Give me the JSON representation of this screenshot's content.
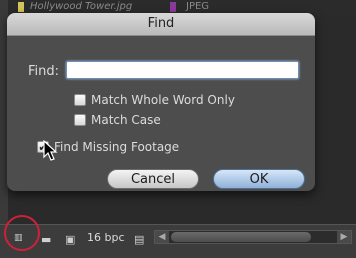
{
  "background": {
    "row_name": "Hollywood Tower.jpg",
    "row_type": "JPEG"
  },
  "dialog": {
    "title": "Find",
    "find_label": "Find:",
    "find_value": "",
    "match_whole_word": {
      "label": "Match Whole Word Only",
      "checked": false
    },
    "match_case": {
      "label": "Match Case",
      "checked": false
    },
    "find_missing_footage": {
      "label": "Find Missing Footage",
      "checked": true
    },
    "cancel_label": "Cancel",
    "ok_label": "OK"
  },
  "toolbar": {
    "bit_depth": "16 bpc",
    "icons": [
      "interpret-footage-icon",
      "new-folder-icon",
      "new-composition-icon",
      "trash-icon"
    ]
  },
  "colors": {
    "accent_circle": "#d0203a",
    "default_button": "#8fb1d8"
  }
}
